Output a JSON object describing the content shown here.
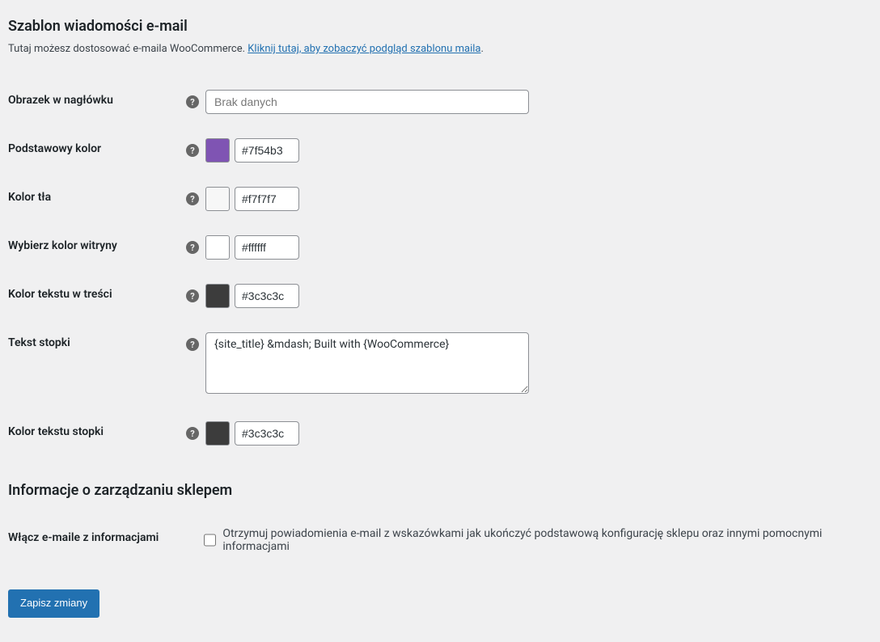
{
  "section1": {
    "heading": "Szablon wiadomości e-mail",
    "description_prefix": "Tutaj możesz dostosować e-maila WooCommerce. ",
    "description_link": "Kliknij tutaj, aby zobaczyć podgląd szablonu maila",
    "description_suffix": "."
  },
  "fields": {
    "header_image": {
      "label": "Obrazek w nagłówku",
      "placeholder": "Brak danych",
      "value": ""
    },
    "base_color": {
      "label": "Podstawowy kolor",
      "value": "#7f54b3",
      "swatch": "#7f54b3"
    },
    "background_color": {
      "label": "Kolor tła",
      "value": "#f7f7f7",
      "swatch": "#f7f7f7"
    },
    "body_background_color": {
      "label": "Wybierz kolor witryny",
      "value": "#ffffff",
      "swatch": "#ffffff"
    },
    "body_text_color": {
      "label": "Kolor tekstu w treści",
      "value": "#3c3c3c",
      "swatch": "#3c3c3c"
    },
    "footer_text": {
      "label": "Tekst stopki",
      "value": "{site_title} &mdash; Built with {WooCommerce}"
    },
    "footer_text_color": {
      "label": "Kolor tekstu stopki",
      "value": "#3c3c3c",
      "swatch": "#3c3c3c"
    }
  },
  "section2": {
    "heading": "Informacje o zarządzaniu sklepem"
  },
  "merchant_notifications": {
    "label": "Włącz e-maile z informacjami",
    "checkbox_label": "Otrzymuj powiadomienia e-mail z wskazówkami jak ukończyć podstawową konfigurację sklepu oraz innymi pomocnymi informacjami"
  },
  "submit": {
    "label": "Zapisz zmiany"
  },
  "help_glyph": "?"
}
